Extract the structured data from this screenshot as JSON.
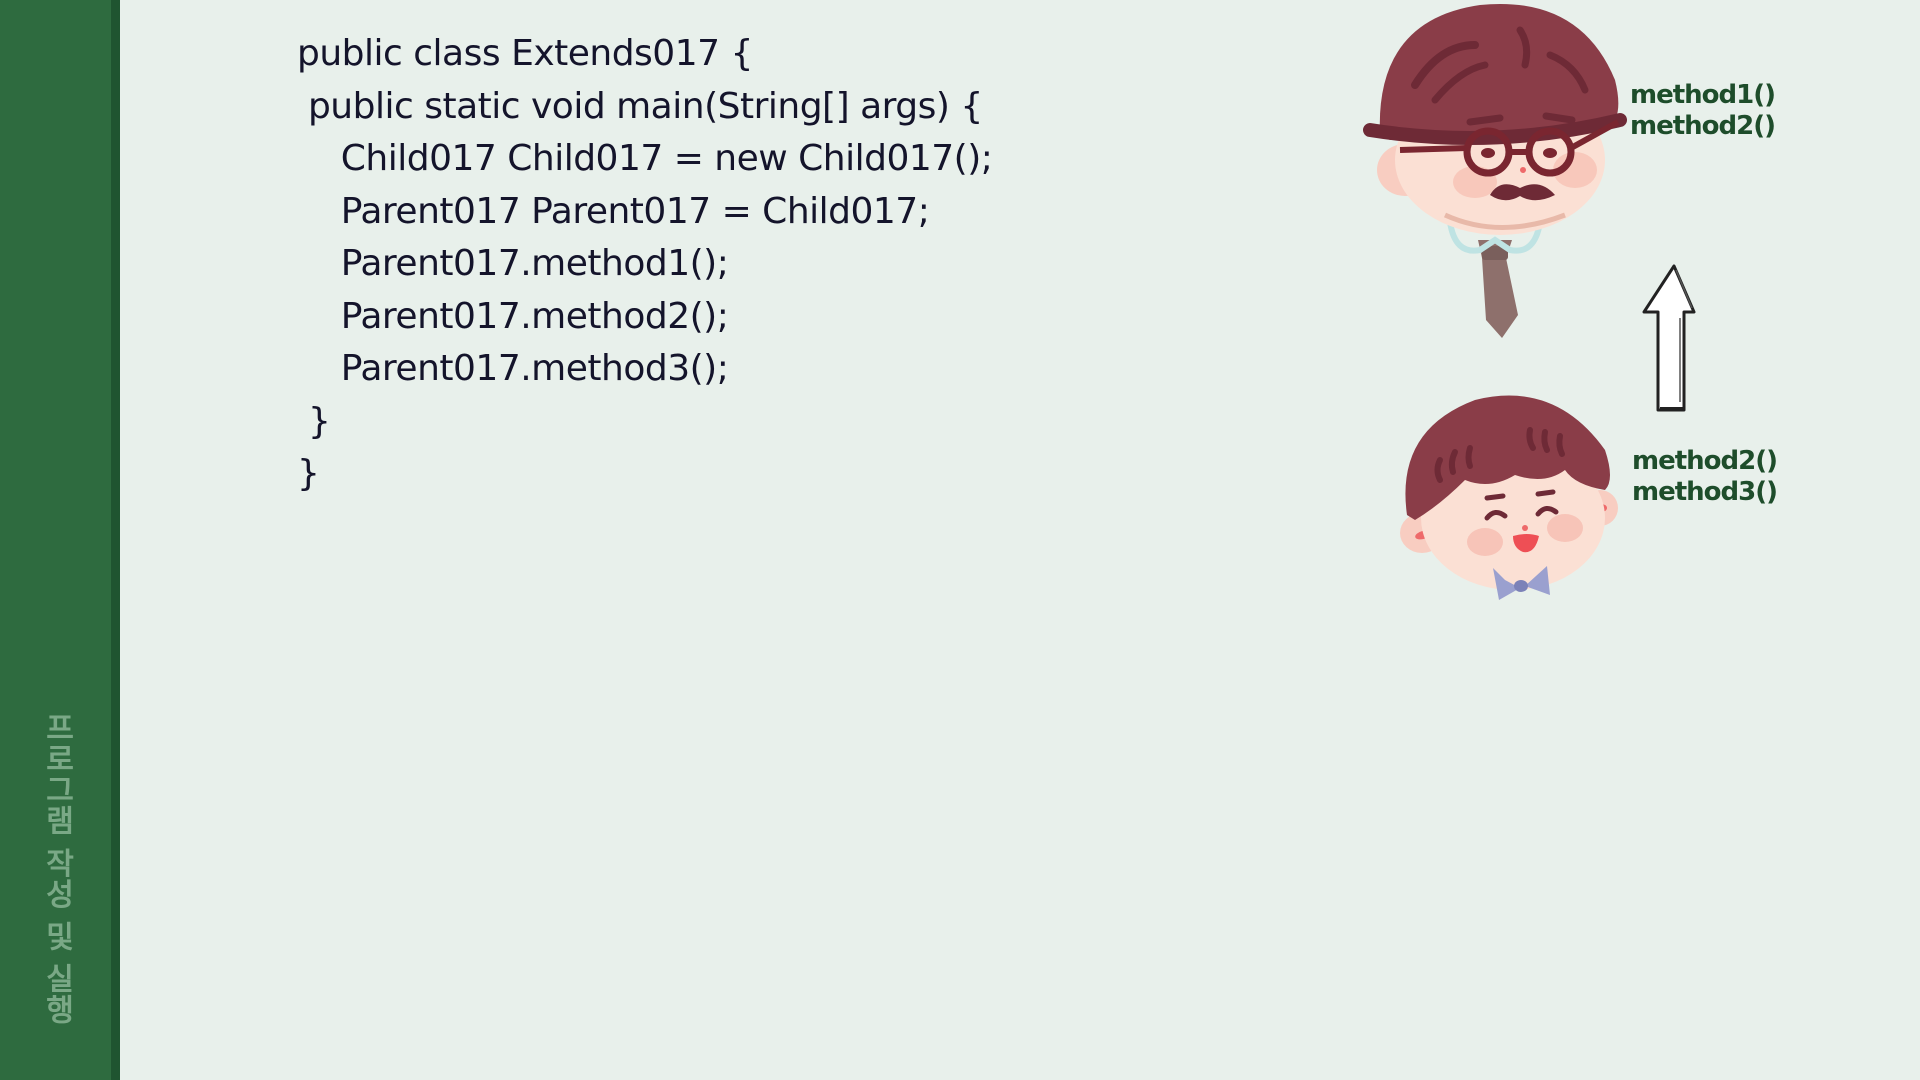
{
  "sidebar": {
    "label": "프로그램 작성 및 실행"
  },
  "code": {
    "lines": [
      "public class Extends017 {",
      " public static void main(String[] args) {",
      "    Child017 Child017 = new Child017();",
      "    Parent017 Parent017 = Child017;",
      "    Parent017.method1();",
      "    Parent017.method2();",
      "    Parent017.method3();",
      " }",
      "}"
    ]
  },
  "parent": {
    "icon": "father-character-icon",
    "methods": [
      "method1()",
      "method2()"
    ]
  },
  "child": {
    "icon": "child-character-icon",
    "methods": [
      "method2()",
      "method3()"
    ]
  },
  "arrow": {
    "icon": "up-arrow-icon"
  },
  "colors": {
    "background": "#e8f0eb",
    "sidebar": "#2e6b3f",
    "code_text": "#14142b",
    "method_text": "#1e4d2b",
    "hair": "#8a3d48"
  }
}
